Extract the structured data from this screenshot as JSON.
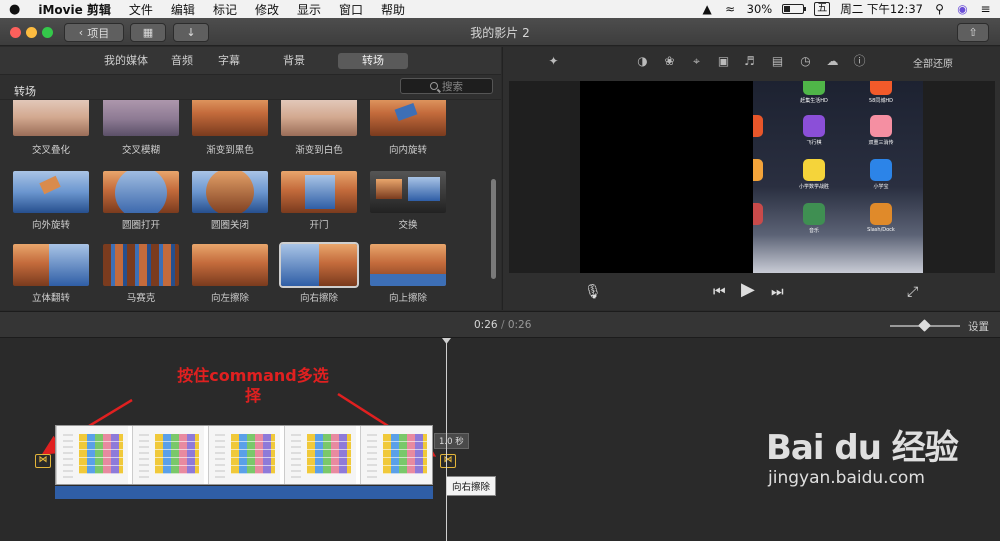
{
  "menubar": {
    "apple_icon": "apple-icon",
    "app_name": "iMovie 剪辑",
    "items": [
      "文件",
      "编辑",
      "标记",
      "修改",
      "显示",
      "窗口",
      "帮助"
    ],
    "battery": "30%",
    "input_method": "五",
    "datetime": "周二 下午12:37"
  },
  "toolbar": {
    "back_label": "项目",
    "title": "我的影片 2"
  },
  "browser": {
    "tabs": [
      "我的媒体",
      "音频",
      "字幕",
      "背景",
      "转场"
    ],
    "selected_tab": "转场",
    "section_title": "转场",
    "search_placeholder": "搜索",
    "transitions": [
      "交叉叠化",
      "交叉模糊",
      "渐变到黑色",
      "渐变到白色",
      "向内旋转",
      "向外旋转",
      "圆圈打开",
      "圆圈关闭",
      "开门",
      "交换",
      "立体翻转",
      "马赛克",
      "向左擦除",
      "向右擦除",
      "向上擦除"
    ],
    "selected_transition": "向右擦除"
  },
  "viewer": {
    "reset_all": "全部还原",
    "tool_icons": [
      "color-balance-icon",
      "color-palette-icon",
      "crop-icon",
      "stabilization-icon",
      "volume-icon",
      "equalizer-icon",
      "speed-icon",
      "filter-icon",
      "info-icon"
    ],
    "ipad_apps": [
      {
        "label": "赶集生活HD",
        "color": "#4fb548"
      },
      {
        "label": "58同城HD",
        "color": "#f25a2a"
      },
      {
        "label": "飞行棋",
        "color": "#8b4fd8"
      },
      {
        "label": "双重三消传",
        "color": "#f58fa2"
      },
      {
        "label": "小学数学战胜",
        "color": "#f5d43a"
      },
      {
        "label": "小学宝",
        "color": "#2c84e8"
      },
      {
        "label": "音乐",
        "color": "#3f8f52"
      },
      {
        "label": "Slash/Dock",
        "color": "#e08a2a"
      }
    ]
  },
  "timeline": {
    "current_time": "0:26",
    "total_time": "0:26",
    "settings_label": "设置",
    "duration_label": "1.0 秒",
    "tooltip": "向右擦除",
    "annotation_line1": "按住command多选",
    "annotation_line2": "择"
  },
  "watermark": {
    "logo": "Bai du 经验",
    "url": "jingyan.baidu.com"
  },
  "colors": {
    "accent_orange": "#e3b53a",
    "annotation_red": "#e02020",
    "audio_blue": "#2f5ea6"
  }
}
